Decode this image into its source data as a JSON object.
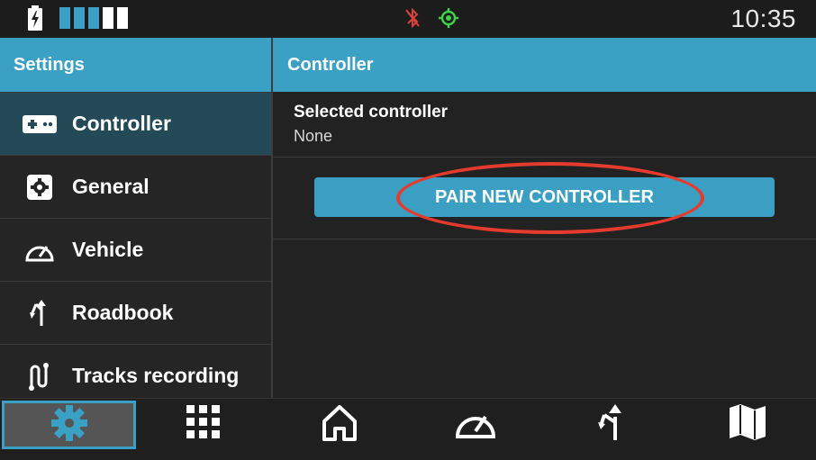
{
  "status_bar": {
    "time": "10:35",
    "icons": [
      "battery-charging-icon",
      "signal-bars-icon",
      "bluetooth-disabled-icon",
      "gps-target-icon"
    ],
    "colors": {
      "bluetooth_off": "#d9423a",
      "gps_on": "#3fd14a",
      "signal_active": "#3a9fc2",
      "signal_inactive": "#ffffff"
    }
  },
  "sidebar": {
    "title": "Settings",
    "items": [
      {
        "label": "Controller",
        "icon": "gamepad-icon",
        "active": true
      },
      {
        "label": "General",
        "icon": "gear-icon",
        "active": false
      },
      {
        "label": "Vehicle",
        "icon": "speedometer-icon",
        "active": false
      },
      {
        "label": "Roadbook",
        "icon": "fork-arrow-icon",
        "active": false
      },
      {
        "label": "Tracks recording",
        "icon": "track-path-icon",
        "active": false
      }
    ]
  },
  "main": {
    "title": "Controller",
    "selected_controller": {
      "label": "Selected controller",
      "value": "None"
    },
    "pair_button": "PAIR NEW CONTROLLER"
  },
  "bottom_nav": [
    {
      "icon": "settings-gear-icon",
      "active": true
    },
    {
      "icon": "apps-grid-icon",
      "active": false
    },
    {
      "icon": "home-icon",
      "active": false
    },
    {
      "icon": "speedometer-icon",
      "active": false
    },
    {
      "icon": "roadbook-arrow-icon",
      "active": false
    },
    {
      "icon": "map-icon",
      "active": false
    }
  ],
  "colors": {
    "accent": "#3aa0c4",
    "active_row": "#244a57",
    "annotation": "#e53b2e"
  }
}
